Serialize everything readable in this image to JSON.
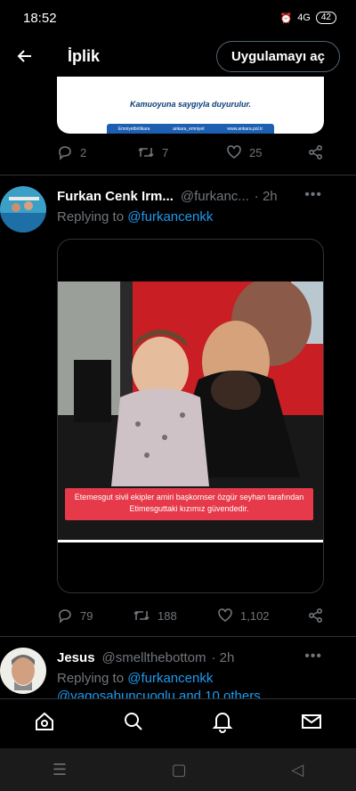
{
  "status": {
    "time": "18:52",
    "battery": "42",
    "net": "4G",
    "bars": "4G",
    "icons": "⋯"
  },
  "header": {
    "title": "İplik",
    "open_app": "Uygulamayı aç"
  },
  "prev_card": {
    "text": "Kamuoyuna saygıyla duyurulur.",
    "strip": [
      "Emniyetbirlikara",
      "ankara_emniyet",
      "www.ankara.pol.tr"
    ]
  },
  "prev_actions": {
    "replies": "2",
    "retweets": "7",
    "likes": "25"
  },
  "tweet": {
    "name": "Furkan Cenk Irm...",
    "handle": "@furkanc...",
    "time": "· 2h",
    "replying_label": "Replying to",
    "replying_to": "@furkancenkk",
    "caption": "Etemesgut sivil ekipler amiri başkomser özgür seyhan tarafından Etimesguttaki kızımız güvendedir.",
    "replies": "79",
    "retweets": "188",
    "likes": "1,102"
  },
  "next_tweet": {
    "name": "Jesus",
    "handle": "@smellthebottom",
    "time": "· 2h",
    "replying_label": "Replying to",
    "replying_to": "@furkancenkk",
    "replying_more": "@vagosabuncuoglu and 10 others"
  },
  "colors": {
    "accent": "#1d9bf0",
    "muted": "#71767b",
    "caption_bg": "#e63a4a"
  }
}
